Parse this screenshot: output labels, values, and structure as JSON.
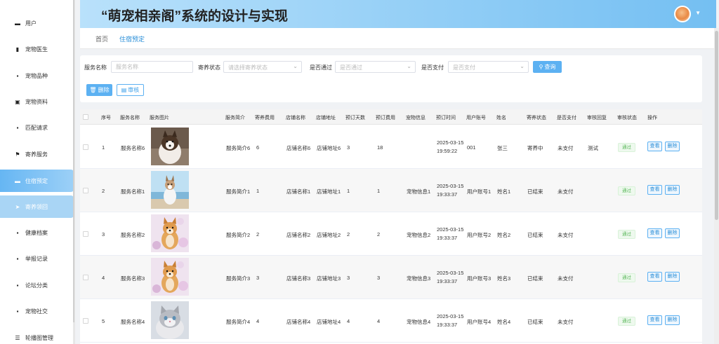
{
  "app": {
    "title": "“萌宠相亲阁”系统的设计与实现"
  },
  "sidebar": {
    "items": [
      {
        "label": "用户",
        "icon": "user-icon"
      },
      {
        "label": "宠物医生",
        "icon": "bar-chart-icon"
      },
      {
        "label": "宠物品种",
        "icon": "grid-icon"
      },
      {
        "label": "宠物资料",
        "icon": "clipboard-icon"
      },
      {
        "label": "匹配请求",
        "icon": "grid-icon"
      },
      {
        "label": "寄养服务",
        "icon": "flag-icon"
      },
      {
        "label": "住宿预定",
        "icon": "bookmark-icon"
      },
      {
        "label": "寄养领回",
        "icon": "send-icon"
      },
      {
        "label": "健康档案",
        "icon": "grid-icon"
      },
      {
        "label": "举报记录",
        "icon": "grid-icon"
      },
      {
        "label": "论坛分类",
        "icon": "grid-icon"
      },
      {
        "label": "宠物社交",
        "icon": "grid-icon"
      },
      {
        "label": "轮播图管理",
        "icon": "sliders-icon"
      }
    ]
  },
  "breadcrumb": {
    "home": "首页",
    "current": "住宿预定"
  },
  "search": {
    "service_name_label": "服务名称",
    "service_name_placeholder": "服务名称",
    "foster_status_label": "寄养状态",
    "foster_status_placeholder": "请选择寄养状态",
    "approved_label": "是否通过",
    "approved_placeholder": "是否通过",
    "paid_label": "是否支付",
    "paid_placeholder": "是否支付",
    "query_button": "查询",
    "delete_button": "删除",
    "audit_button": "审核"
  },
  "table": {
    "headers": {
      "index": "序号",
      "service_name": "服务名称",
      "service_image": "服务图片",
      "service_intro": "服务简介",
      "foster_fee": "寄养费用",
      "shop_name": "店铺名称",
      "shop_address": "店铺地址",
      "booking_days": "预订天数",
      "booking_fee": "预订费用",
      "pet_info": "宠物信息",
      "booking_time": "预订时间",
      "user_account": "用户账号",
      "name": "姓名",
      "foster_status": "寄养状态",
      "paid": "是否支付",
      "audit_reply": "审核回复",
      "audit_status": "审核状态",
      "actions": "操作"
    },
    "view_label": "查看",
    "delete_label": "删除",
    "rows": [
      {
        "index": "1",
        "service_name": "服务名称6",
        "image": "dog-husky",
        "service_intro": "服务简介6",
        "foster_fee": "6",
        "shop_name": "店铺名称6",
        "shop_address": "店铺地址6",
        "booking_days": "3",
        "booking_fee": "18",
        "pet_info": "",
        "booking_time": "2025-03-15 19:59:22",
        "user_account": "001",
        "name": "张三",
        "foster_status": "寄养中",
        "paid": "未支付",
        "audit_reply": "测试",
        "audit_status": "通过"
      },
      {
        "index": "2",
        "service_name": "服务名称1",
        "image": "dog-beach",
        "service_intro": "服务简介1",
        "foster_fee": "1",
        "shop_name": "店铺名称1",
        "shop_address": "店铺地址1",
        "booking_days": "1",
        "booking_fee": "1",
        "pet_info": "宠物信息1",
        "booking_time": "2025-03-15 19:33:37",
        "user_account": "用户账号1",
        "name": "姓名1",
        "foster_status": "已结束",
        "paid": "未支付",
        "audit_reply": "",
        "audit_status": "通过"
      },
      {
        "index": "3",
        "service_name": "服务名称2",
        "image": "dog-shiba",
        "service_intro": "服务简介2",
        "foster_fee": "2",
        "shop_name": "店铺名称2",
        "shop_address": "店铺地址2",
        "booking_days": "2",
        "booking_fee": "2",
        "pet_info": "宠物信息2",
        "booking_time": "2025-03-15 19:33:37",
        "user_account": "用户账号2",
        "name": "姓名2",
        "foster_status": "已结束",
        "paid": "未支付",
        "audit_reply": "",
        "audit_status": "通过"
      },
      {
        "index": "4",
        "service_name": "服务名称3",
        "image": "dog-shiba",
        "service_intro": "服务简介3",
        "foster_fee": "3",
        "shop_name": "店铺名称3",
        "shop_address": "店铺地址3",
        "booking_days": "3",
        "booking_fee": "3",
        "pet_info": "宠物信息3",
        "booking_time": "2025-03-15 19:33:37",
        "user_account": "用户账号3",
        "name": "姓名3",
        "foster_status": "已结束",
        "paid": "未支付",
        "audit_reply": "",
        "audit_status": "通过"
      },
      {
        "index": "5",
        "service_name": "服务名称4",
        "image": "cat-gray",
        "service_intro": "服务简介4",
        "foster_fee": "4",
        "shop_name": "店铺名称4",
        "shop_address": "店铺地址4",
        "booking_days": "4",
        "booking_fee": "4",
        "pet_info": "宠物信息4",
        "booking_time": "2025-03-15 19:33:37",
        "user_account": "用户账号4",
        "name": "姓名4",
        "foster_status": "已结束",
        "paid": "未支付",
        "audit_reply": "",
        "audit_status": "通过"
      }
    ]
  },
  "colors": {
    "accent": "#5cb1f2",
    "header_start": "#b9e1fb",
    "header_end": "#74bff2",
    "success": "#5bb85b"
  }
}
